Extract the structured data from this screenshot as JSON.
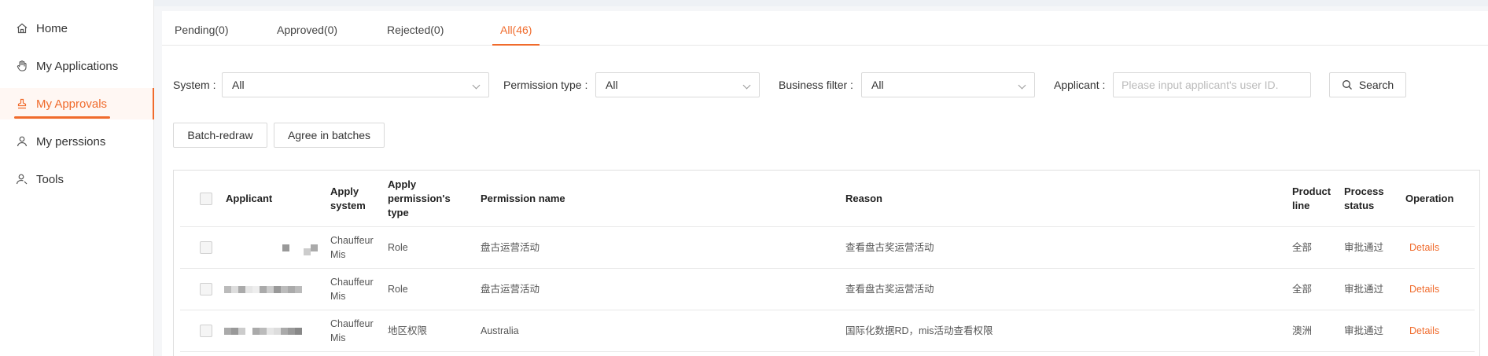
{
  "sidebar": {
    "items": [
      {
        "label": "Home",
        "icon": "home-icon"
      },
      {
        "label": "My Applications",
        "icon": "hand-icon"
      },
      {
        "label": "My Approvals",
        "icon": "stamp-icon",
        "active": true
      },
      {
        "label": "My perssions",
        "icon": "user-icon"
      },
      {
        "label": "Tools",
        "icon": "user-tools-icon"
      }
    ]
  },
  "tabs": [
    {
      "label": "Pending(0)"
    },
    {
      "label": "Approved(0)"
    },
    {
      "label": "Rejected(0)"
    },
    {
      "label": "All(46)",
      "active": true
    }
  ],
  "filters": {
    "system_label": "System :",
    "system_value": "All",
    "permission_type_label": "Permission type :",
    "permission_type_value": "All",
    "business_filter_label": "Business filter :",
    "business_filter_value": "All",
    "applicant_label": "Applicant :",
    "applicant_placeholder": "Please input applicant's user ID.",
    "search_label": "Search"
  },
  "actions": {
    "batch_redraw": "Batch-redraw",
    "agree_batches": "Agree in batches"
  },
  "table": {
    "headers": {
      "applicant": "Applicant",
      "apply_system": "Apply system",
      "apply_permission_type": "Apply permission's type",
      "permission_name": "Permission name",
      "reason": "Reason",
      "product_line": "Product line",
      "process_status": "Process status",
      "operation": "Operation"
    },
    "rows": [
      {
        "system": "Chauffeur Mis",
        "type": "Role",
        "permission": "盘古运营活动",
        "reason": "查看盘古奖运营活动",
        "product_line": "全部",
        "status": "审批通过",
        "operation": "Details"
      },
      {
        "system": "Chauffeur Mis",
        "type": "Role",
        "permission": "盘古运营活动",
        "reason": "查看盘古奖运营活动",
        "product_line": "全部",
        "status": "审批通过",
        "operation": "Details"
      },
      {
        "system": "Chauffeur Mis",
        "type": "地区权限",
        "permission": "Australia",
        "reason": "国际化数据RD，mis活动查看权限",
        "product_line": "澳洲",
        "status": "审批通过",
        "operation": "Details"
      }
    ]
  },
  "colors": {
    "accent": "#f06b2c"
  }
}
